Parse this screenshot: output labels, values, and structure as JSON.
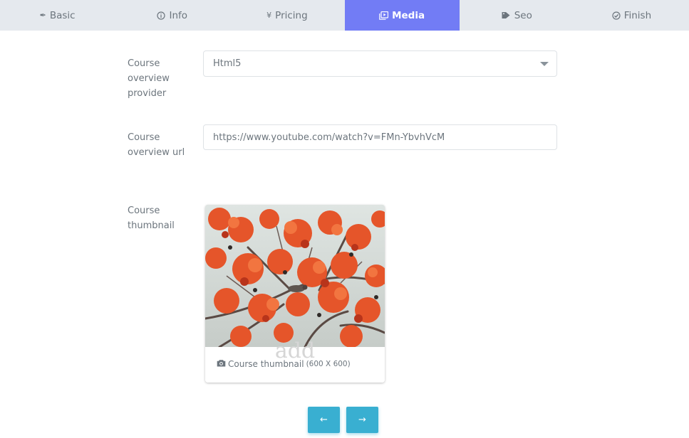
{
  "tabs": [
    {
      "label": "Basic",
      "icon": "feather-icon",
      "active": false
    },
    {
      "label": "Info",
      "icon": "info-icon",
      "active": false
    },
    {
      "label": "Pricing",
      "icon": "yen-icon",
      "active": false
    },
    {
      "label": "Media",
      "icon": "media-icon",
      "active": true
    },
    {
      "label": "Seo",
      "icon": "tag-icon",
      "active": false
    },
    {
      "label": "Finish",
      "icon": "check-circle-icon",
      "active": false
    }
  ],
  "form": {
    "provider_label": "Course overview provider",
    "provider_value": "Html5",
    "url_label": "Course overview url",
    "url_value": "https://www.youtube.com/watch?v=FMn-YbvhVcM",
    "thumbnail_label": "Course thumbnail",
    "thumbnail_watermark": "add",
    "thumbnail_caption": "Course thumbnail",
    "thumbnail_dimensions": "(600 X 600)"
  },
  "nav": {
    "prev_symbol": "←",
    "next_symbol": "→"
  },
  "colors": {
    "accent": "#727cf5",
    "tab_bar": "#e5e9ee",
    "button": "#39afd1"
  }
}
